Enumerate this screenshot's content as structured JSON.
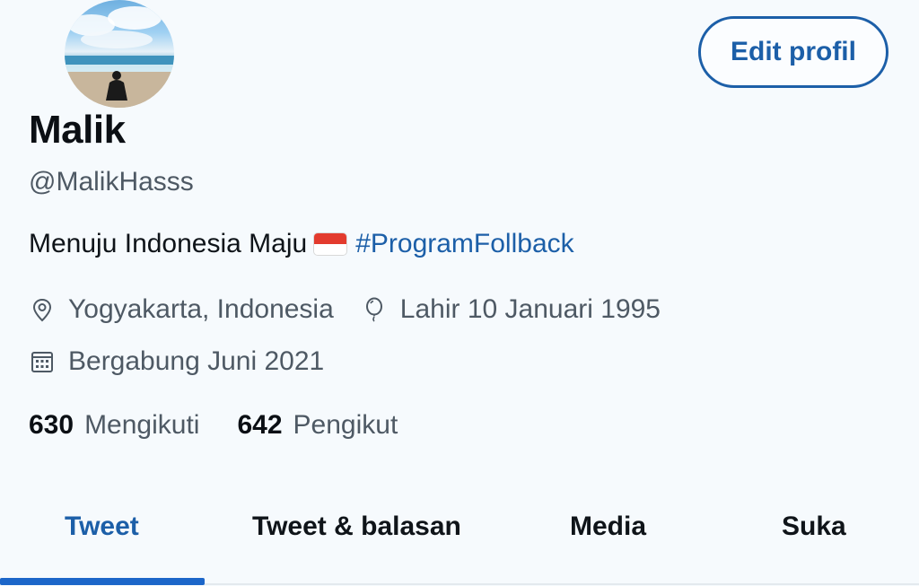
{
  "profile": {
    "name": "Malik",
    "handle": "@MalikHasss",
    "bio_text": "Menuju Indonesia Maju",
    "bio_flag": "flag-indonesia-icon",
    "bio_hashtag": "#ProgramFollback",
    "location": "Yogyakarta, Indonesia",
    "birthday": "Lahir 10 Januari 1995",
    "joined": "Bergabung Juni 2021",
    "following_count": "630",
    "following_label": "Mengikuti",
    "followers_count": "642",
    "followers_label": "Pengikut"
  },
  "actions": {
    "edit_profile": "Edit profil"
  },
  "tabs": [
    {
      "label": "Tweet",
      "active": true
    },
    {
      "label": "Tweet & balasan",
      "active": false
    },
    {
      "label": "Media",
      "active": false
    },
    {
      "label": "Suka",
      "active": false
    }
  ],
  "colors": {
    "accent": "#1c5fa8",
    "tab_indicator": "#1c66c9",
    "secondary_text": "#4e5964",
    "background": "#f6fafd"
  },
  "icons": {
    "location": "location-pin-icon",
    "birthday": "balloon-icon",
    "joined": "calendar-icon"
  }
}
